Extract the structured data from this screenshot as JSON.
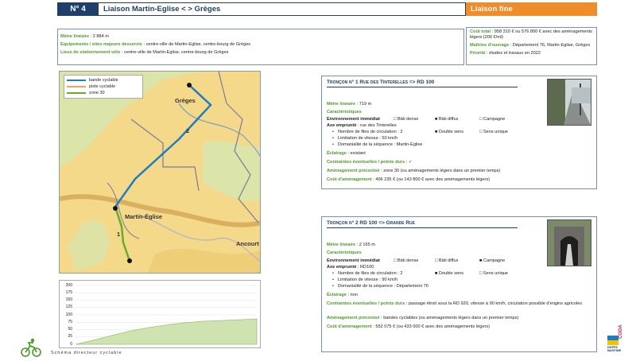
{
  "header": {
    "number": "N° 4",
    "title": "Liaison Martin-Eglise < > Grèges",
    "type": "Liaison fine"
  },
  "info": {
    "lineaire_label": "Mètre linéaire",
    "lineaire_value": ": 2 884 m",
    "equip_label": "Equipements / sites majeurs desservis",
    "equip_value": ": centre-ville de Martin-Eglise, centre-bourg de Grèges",
    "stationnement_label": "Lieux de stationnement vélo",
    "stationnement_value": ": centre-ville de Martin-Eglise, centre-bourg de Grèges",
    "cout_label": "Coût total",
    "cout_value": ": 958 310 € ou 576 800 € avec des aménagements légers (200 €/ml)",
    "maitrise_label": "Maîtrise d'ouvrage",
    "maitrise_value": ": Département 76, Martin-Eglise, Grèges",
    "priorite_label": "Priorité",
    "priorite_value": ": études et travaux en 2022"
  },
  "map": {
    "legend": [
      "bande cyclable",
      "piste cyclable",
      "zone 30"
    ],
    "labels": {
      "greges": "Grèges",
      "martin": "Martin-Église",
      "ancourt": "Ancourt",
      "seg1": "1",
      "seg2": "2"
    }
  },
  "colors": {
    "bande": "#1f7dc1",
    "piste": "#f0a060",
    "zone30": "#6aaa2a",
    "navy": "#1f3f6b",
    "orange": "#f08c2a",
    "green": "#4e9a2c"
  },
  "profile": {
    "y_ticks": [
      "200",
      "175",
      "150",
      "125",
      "100",
      "75",
      "50",
      "25",
      "0"
    ],
    "ylim": [
      0,
      200
    ]
  },
  "troncon1": {
    "title": "Tronçon n° 1 Rue des Tinterelles => RD 100",
    "lineaire_label": "Mètre linéaire",
    "lineaire_value": ": 719 m",
    "caract": "Caractéristiques",
    "env_label": "Environnement immédiat",
    "env_opts": [
      "□ Bâti dense",
      "■ Bâti diffus",
      "□ Campagne"
    ],
    "axe_label": "Axe emprunté",
    "axe_value": ": rue des Tinterelles",
    "files": "Nombre de files de circulation : 2",
    "sens_opts": [
      "■ Double sens",
      "□ Sens unique"
    ],
    "vitesse": "Limitation de vitesse : 50 km/h",
    "domanialite": "Domanialité de la séquence : Martin-Église",
    "eclairage_label": "Éclairage",
    "eclairage_value": ": existant",
    "contraintes_label": "Contraintes éventuelles / points durs",
    "contraintes_value": ": ✓",
    "amenag_label": "Aménagement préconisé",
    "amenag_value": ": zone 30 (ou aménagements légers dans un premier temps)",
    "cout_label": "Coût d'aménagement",
    "cout_value": ": 406 235 € (ou 143 800 € avec des aménagements légers)"
  },
  "troncon2": {
    "title": "Tronçon n° 2 RD 100 => Grande Rue",
    "lineaire_label": "Mètre linéaire",
    "lineaire_value": ": 2 165 m",
    "caract": "Caractéristiques",
    "env_label": "Environnement immédiat",
    "env_opts": [
      "□ Bâti dense",
      "□ Bâti diffus",
      "■ Campagne"
    ],
    "axe_label": "Axe emprunté",
    "axe_value": ": RD100",
    "files": "Nombre de files de circulation : 2",
    "sens_opts": [
      "■ Double sens",
      "□ Sens unique"
    ],
    "vitesse": "Limitation de vitesse : 90 km/h",
    "domanialite": "Domanialité de la séquence : Département 76",
    "eclairage_label": "Éclairage",
    "eclairage_value": ": non",
    "contraintes_label": "Contraintes éventuelles / points durs",
    "contraintes_value": ": passage étroit sous la RD 920, vitesse à 90 km/h, circulation possible d'engins agricoles",
    "amenag_label": "Aménagement préconisé",
    "amenag_value": ": bandes cyclables (ou aménagements légers dans un premier temps)",
    "cout_label": "Coût d'aménagement",
    "cout_value": ": 552 075 € (ou 433 000 € avec des aménagements légers)"
  },
  "footer": {
    "text": "Schéma directeur cyclable",
    "logo_text": "CODA",
    "logo_sub": "DIEPPE MARITIME"
  }
}
